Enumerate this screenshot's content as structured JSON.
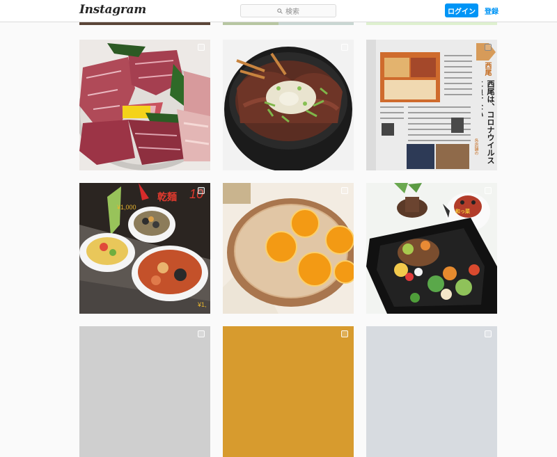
{
  "nav": {
    "logo": "Instagram",
    "search_placeholder": "検索",
    "login_label": "ログイン",
    "signup_label": "登録"
  },
  "icons": {
    "search": "search-icon",
    "select": "square-checkbox-icon"
  },
  "colors": {
    "accent": "#0095f6",
    "background": "#fafafa",
    "border": "#dbdbdb"
  },
  "posts": [
    {
      "id": "yakiniku-platter"
    },
    {
      "id": "roast-beef-bowl"
    },
    {
      "id": "magazine-article",
      "text": {
        "heading": "西尾は、コロナウイルスに負けない",
        "tag": "西尾",
        "sub": "各店舗の"
      }
    },
    {
      "id": "noodle-dishes",
      "text": {
        "title": "乾麺",
        "price1": "¥1,000",
        "price2": "¥1,",
        "num": "10"
      }
    },
    {
      "id": "orange-pizza"
    },
    {
      "id": "bento-box",
      "text": {
        "figure_label": "和っ菜"
      }
    }
  ]
}
